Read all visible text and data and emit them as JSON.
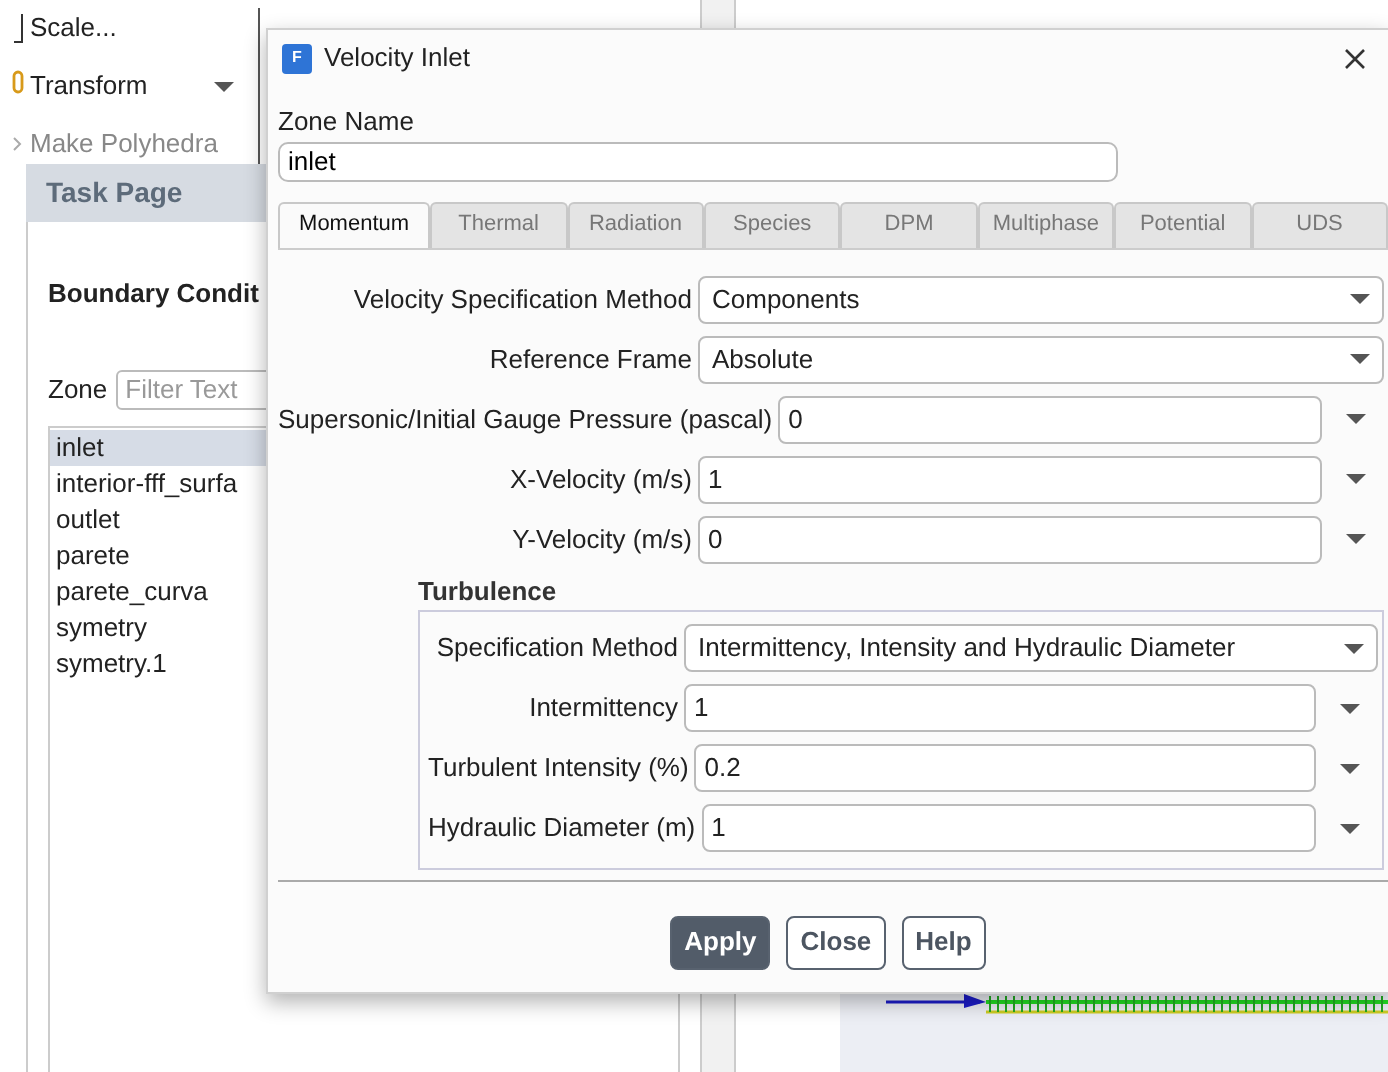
{
  "ribbon": {
    "items": [
      {
        "label": "Scale...",
        "disabled": false,
        "dropdown": false
      },
      {
        "label": "Transform",
        "disabled": false,
        "dropdown": true
      },
      {
        "label": "Make Polyhedra",
        "disabled": true,
        "dropdown": false
      }
    ]
  },
  "task_page": {
    "header": "Task Page",
    "title": "Boundary Condit",
    "zone_label": "Zone",
    "filter": {
      "placeholder": "Filter Text"
    },
    "zones": [
      {
        "label": "inlet",
        "selected": true
      },
      {
        "label": "interior-fff_surfa",
        "selected": false
      },
      {
        "label": "outlet",
        "selected": false
      },
      {
        "label": "parete",
        "selected": false
      },
      {
        "label": "parete_curva",
        "selected": false
      },
      {
        "label": "symetry",
        "selected": false
      },
      {
        "label": "symetry.1",
        "selected": false
      }
    ]
  },
  "dialog": {
    "logo_text": "F",
    "title": "Velocity Inlet",
    "zone_name_label": "Zone Name",
    "zone_name": "inlet",
    "tabs": [
      {
        "label": "Momentum",
        "selected": true
      },
      {
        "label": "Thermal",
        "selected": false
      },
      {
        "label": "Radiation",
        "selected": false
      },
      {
        "label": "Species",
        "selected": false
      },
      {
        "label": "DPM",
        "selected": false
      },
      {
        "label": "Multiphase",
        "selected": false
      },
      {
        "label": "Potential",
        "selected": false
      },
      {
        "label": "UDS",
        "selected": false
      }
    ],
    "fields": [
      {
        "kind": "dropdown",
        "label": "Velocity Specification Method",
        "value": "Components"
      },
      {
        "kind": "dropdown",
        "label": "Reference Frame",
        "value": "Absolute"
      },
      {
        "kind": "number",
        "label": "Supersonic/Initial Gauge Pressure (pascal)",
        "value": "0"
      },
      {
        "kind": "number",
        "label": "X-Velocity (m/s)",
        "value": "1"
      },
      {
        "kind": "number",
        "label": "Y-Velocity (m/s)",
        "value": "0"
      }
    ],
    "turbulence": {
      "title": "Turbulence",
      "fields": [
        {
          "kind": "dropdown",
          "label": "Specification Method",
          "value": "Intermittency, Intensity and Hydraulic Diameter"
        },
        {
          "kind": "number",
          "label": "Intermittency",
          "value": "1"
        },
        {
          "kind": "number",
          "label": "Turbulent Intensity (%)",
          "value": "0.2"
        },
        {
          "kind": "number",
          "label": "Hydraulic Diameter (m)",
          "value": "1"
        }
      ]
    },
    "buttons": [
      {
        "label": "Apply",
        "primary": true
      },
      {
        "label": "Close",
        "primary": false
      },
      {
        "label": "Help",
        "primary": false
      }
    ]
  }
}
